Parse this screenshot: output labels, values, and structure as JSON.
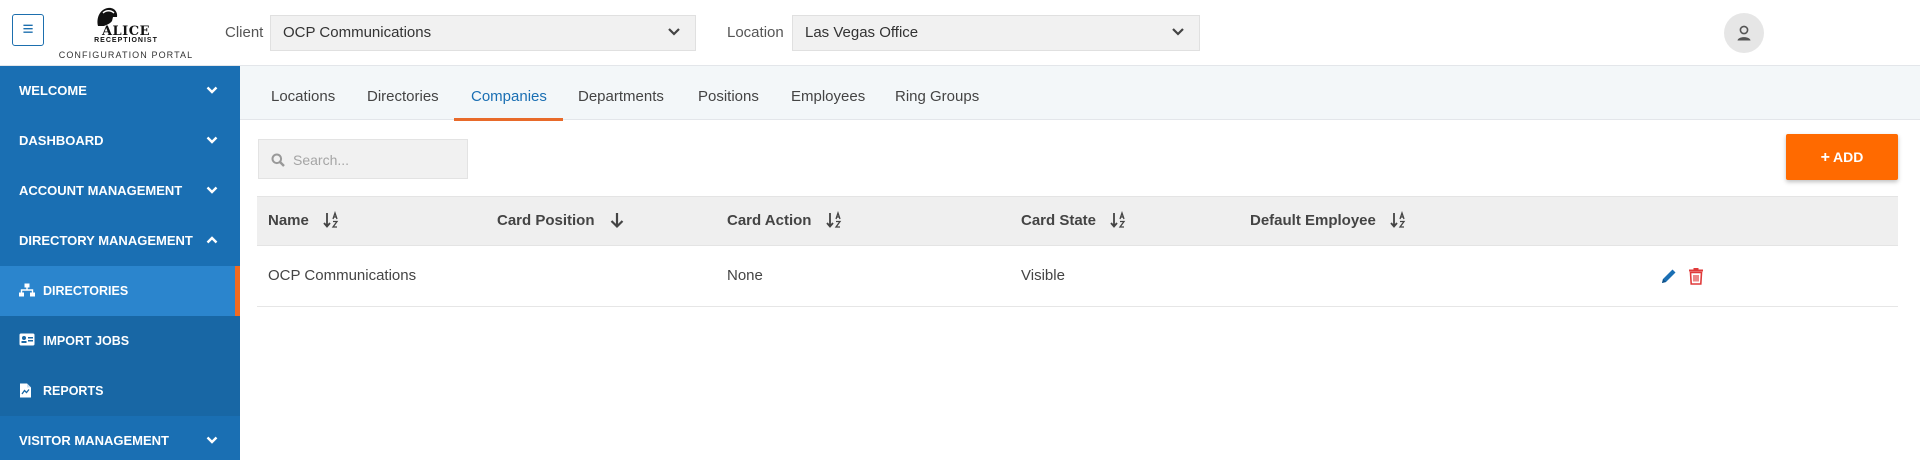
{
  "header": {
    "menu_glyph": "≡",
    "logo": {
      "name": "ALICE",
      "sub": "RECEPTIONIST",
      "portal": "CONFIGURATION PORTAL"
    },
    "client_label": "Client",
    "client_value": "OCP Communications",
    "location_label": "Location",
    "location_value": "Las Vegas Office",
    "icons": {
      "menu": "hamburger-icon",
      "dropdown": "chevron-down-icon",
      "user": "user-icon"
    }
  },
  "sidebar": {
    "sections": [
      {
        "label": "WELCOME",
        "expanded": false
      },
      {
        "label": "DASHBOARD",
        "expanded": false
      },
      {
        "label": "ACCOUNT MANAGEMENT",
        "expanded": false
      },
      {
        "label": "DIRECTORY MANAGEMENT",
        "expanded": true
      }
    ],
    "sub_items": [
      {
        "label": "DIRECTORIES",
        "icon": "sitemap-icon",
        "active": true
      },
      {
        "label": "IMPORT JOBS",
        "icon": "id-card-icon",
        "active": false
      },
      {
        "label": "REPORTS",
        "icon": "file-icon",
        "active": false
      }
    ],
    "next_section": {
      "label": "VISITOR MANAGEMENT",
      "expanded": false
    }
  },
  "tabs": [
    {
      "label": "Locations"
    },
    {
      "label": "Directories"
    },
    {
      "label": "Companies",
      "active": true
    },
    {
      "label": "Departments"
    },
    {
      "label": "Positions"
    },
    {
      "label": "Employees"
    },
    {
      "label": "Ring Groups"
    }
  ],
  "toolbar": {
    "search_placeholder": "Search...",
    "add_label": "ADD",
    "add_glyph": "+"
  },
  "table": {
    "columns": [
      {
        "label": "Name",
        "sort": "alpha"
      },
      {
        "label": "Card Position",
        "sort": "down"
      },
      {
        "label": "Card Action",
        "sort": "alpha"
      },
      {
        "label": "Card State",
        "sort": "alpha"
      },
      {
        "label": "Default Employee",
        "sort": "alpha"
      }
    ],
    "rows": [
      {
        "name": "OCP Communications",
        "card_position": "",
        "card_action": "None",
        "card_state": "Visible",
        "default_employee": ""
      }
    ],
    "row_actions": [
      "pencil-icon",
      "trash-icon"
    ]
  },
  "colors": {
    "primary": "#1a6fb3",
    "sidebar_active": "#2b85cd",
    "accent": "#ff6a00",
    "edit_icon": "#1a6fb3",
    "delete_icon": "#e03a3a"
  }
}
